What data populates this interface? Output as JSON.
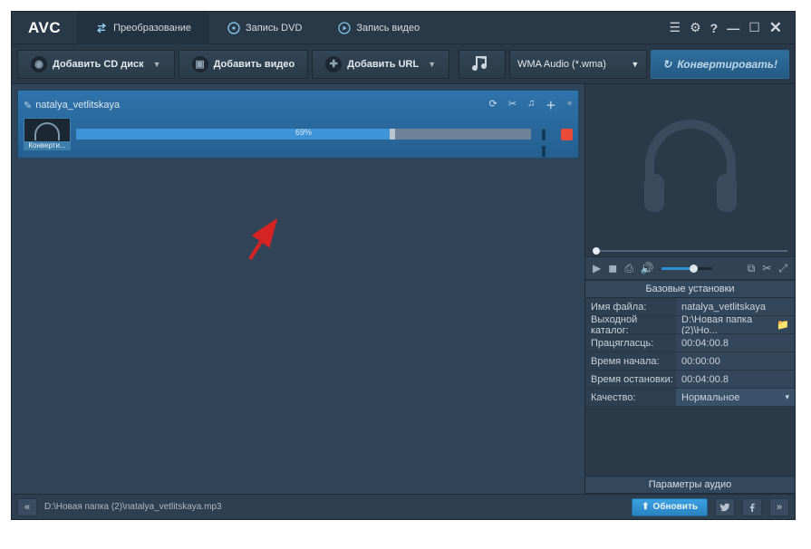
{
  "app": {
    "logo": "AVC"
  },
  "titlebar": {
    "tabs": [
      {
        "label": "Преобразование"
      },
      {
        "label": "Запись DVD"
      },
      {
        "label": "Запись видео"
      }
    ]
  },
  "toolbar": {
    "add_cd": "Добавить CD диск",
    "add_video": "Добавить видео",
    "add_url": "Добавить URL",
    "format_selected": "WMA Audio (*.wma)",
    "convert": "Конвертировать!"
  },
  "item": {
    "filename": "natalya_vetlitskaya",
    "thumb_label": "Конверти...",
    "progress_percent": 69,
    "progress_text": "69%"
  },
  "side": {
    "section_basic": "Базовые установки",
    "rows": {
      "filename_k": "Имя файла:",
      "filename_v": "natalya_vetlitskaya",
      "outdir_k": "Выходной каталог:",
      "outdir_v": "D:\\Новая папка (2)\\Но...",
      "duration_k": "Працягласць:",
      "duration_v": "00:04:00.8",
      "start_k": "Время начала:",
      "start_v": "00:00:00",
      "stop_k": "Время остановки:",
      "stop_v": "00:04:00.8",
      "quality_k": "Качество:",
      "quality_v": "Нормальное"
    },
    "section_audio": "Параметры аудио"
  },
  "status": {
    "path": "D:\\Новая папка (2)\\natalya_vetlitskaya.mp3",
    "update": "Обновить"
  }
}
